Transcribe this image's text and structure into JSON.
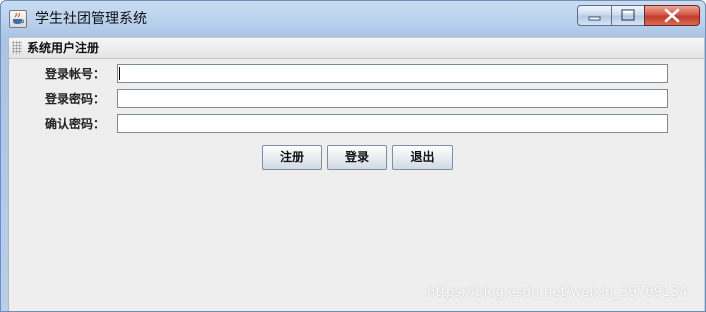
{
  "window": {
    "title": "学生社团管理系统",
    "icon": "java-coffee-icon"
  },
  "panel": {
    "title": "系统用户注册"
  },
  "form": {
    "fields": [
      {
        "label": "登录帐号：",
        "value": "",
        "placeholder": ""
      },
      {
        "label": "登录密码：",
        "value": "",
        "placeholder": ""
      },
      {
        "label": "确认密码：",
        "value": "",
        "placeholder": ""
      }
    ]
  },
  "buttons": {
    "register": "注册",
    "login": "登录",
    "exit": "退出"
  },
  "watermark": "https://blog.csdn.net/weixin_39709134",
  "colors": {
    "titlebar": "#bcd3ee",
    "close_button": "#c23b2b",
    "client_background": "#eeeeee"
  }
}
